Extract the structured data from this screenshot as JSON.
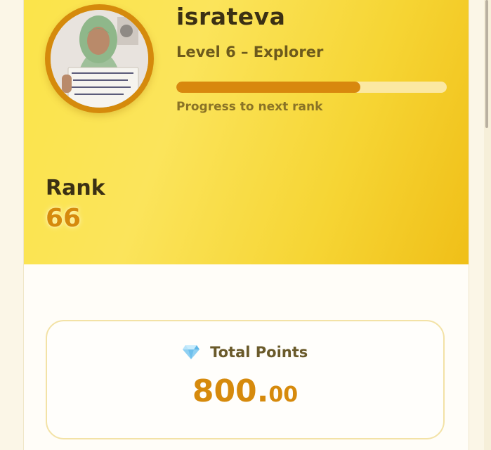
{
  "profile": {
    "username": "israteva",
    "level_text": "Level 6 – Explorer",
    "progress_label": "Progress to next rank",
    "progress_fraction": 0.68,
    "avatar_icon": "profile-photo"
  },
  "rank": {
    "label": "Rank",
    "value": "66"
  },
  "points": {
    "title": "Total Points",
    "icon": "gem-icon",
    "integer_part": "800",
    "decimal_point": ".",
    "decimal_part": "00"
  },
  "colors": {
    "accent": "#d68a0c",
    "hero_gradient_start": "#fbe44a",
    "hero_gradient_end": "#f0bf18",
    "text_dark": "#3b3014"
  }
}
